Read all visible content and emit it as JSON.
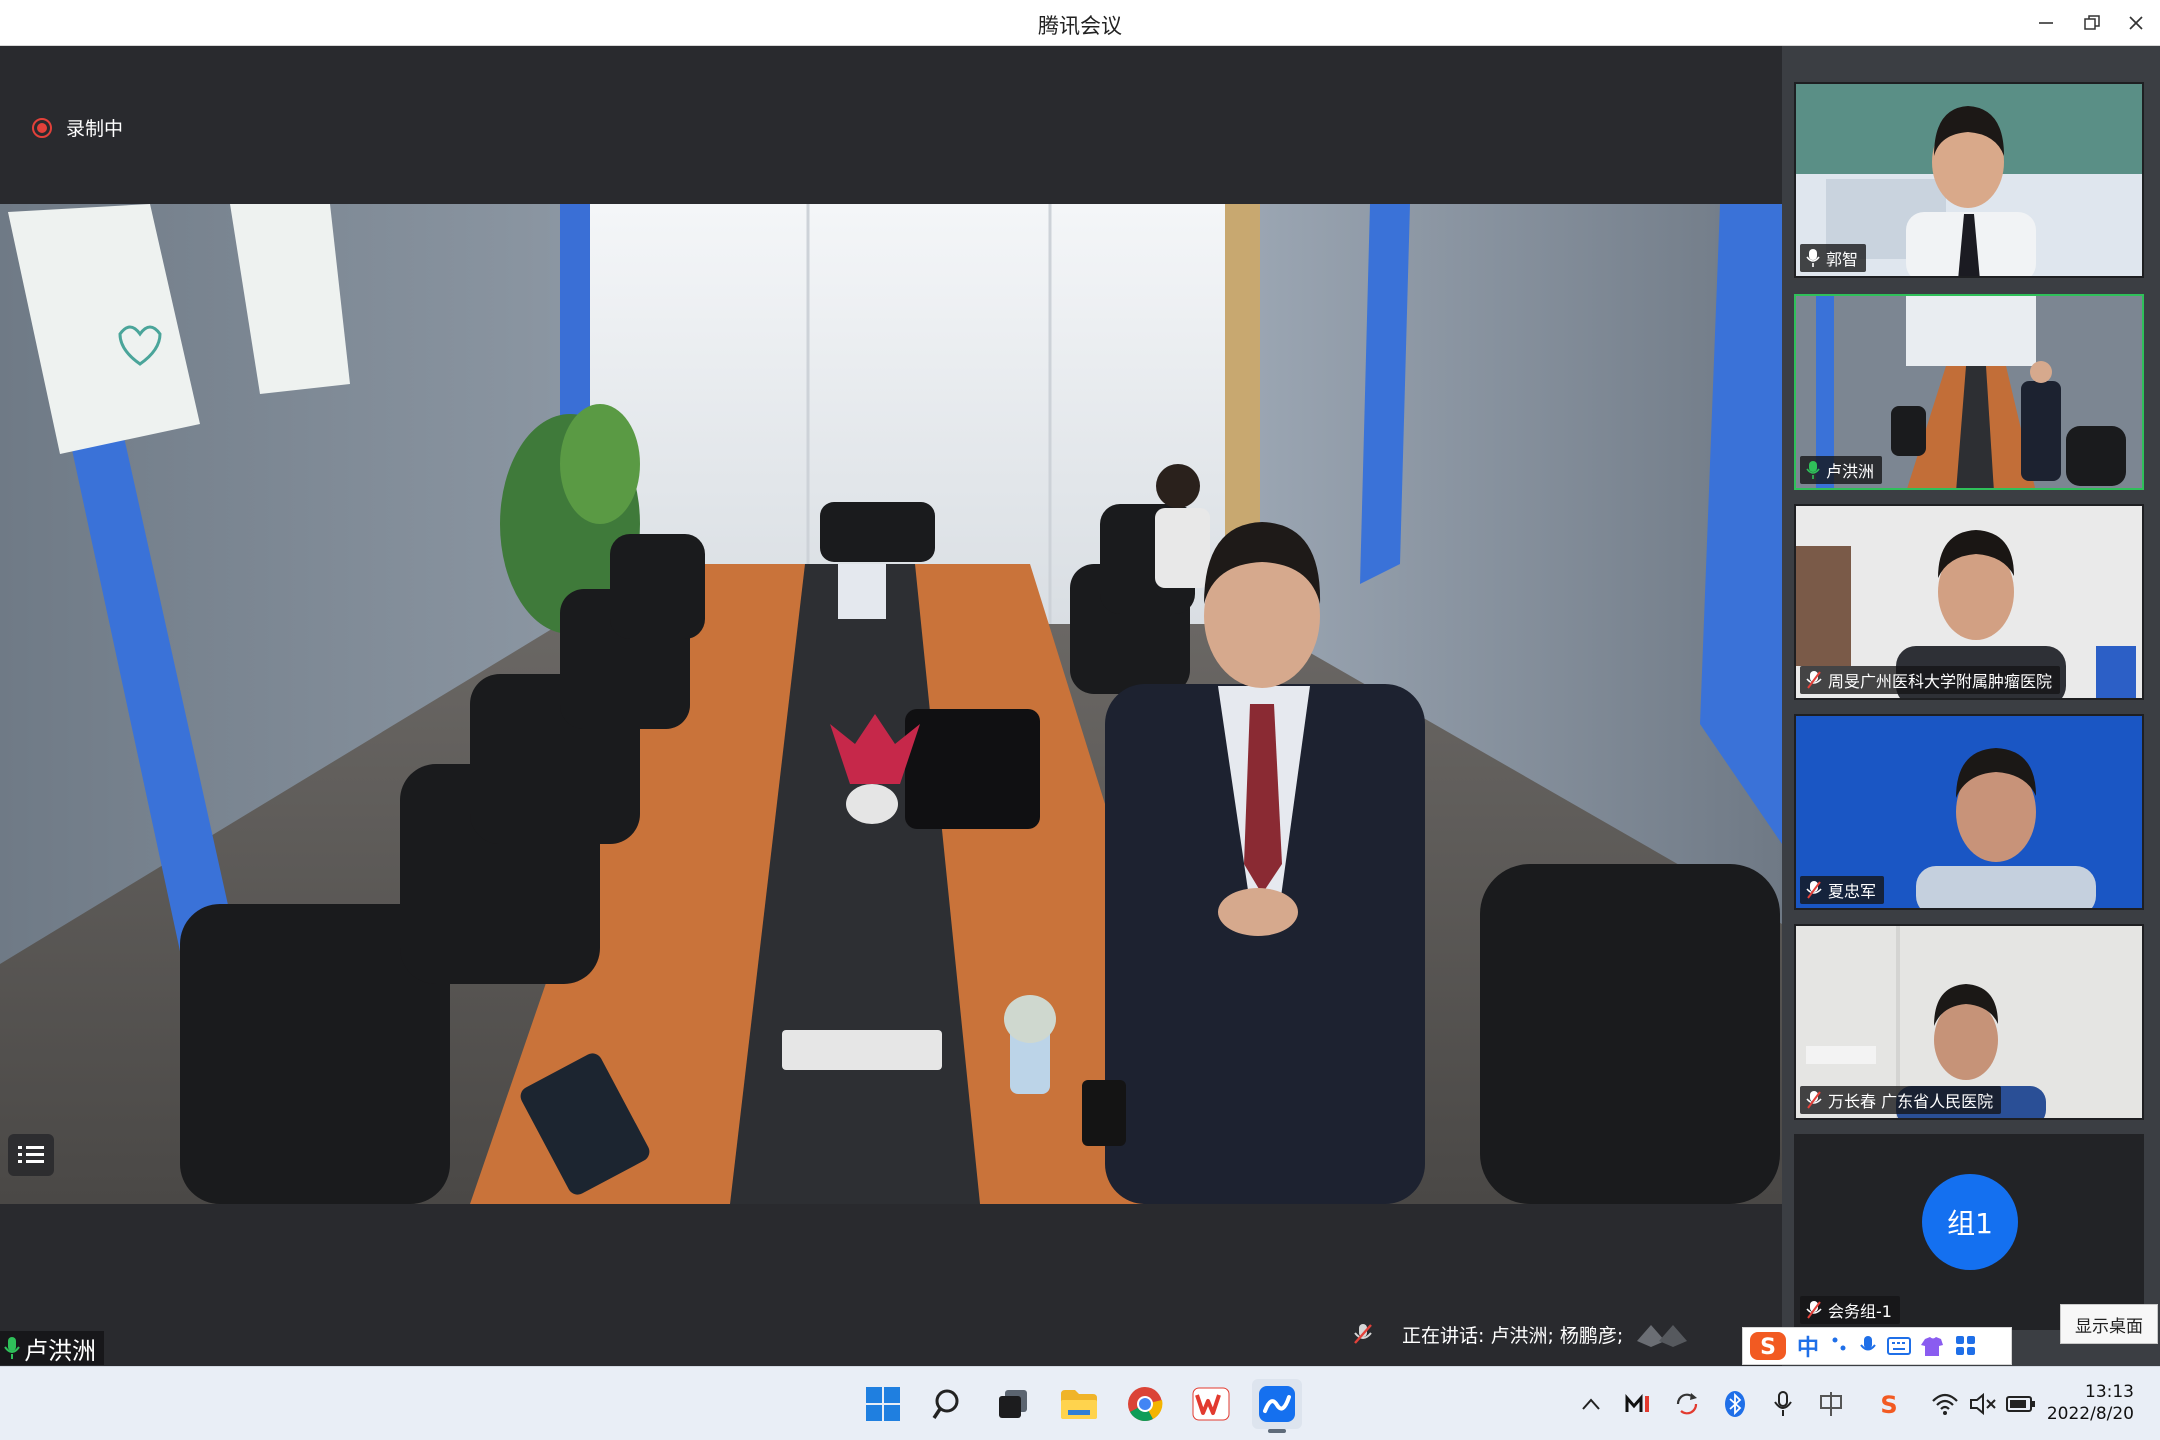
{
  "window": {
    "title": "腾讯会议"
  },
  "stage": {
    "recording_label": "录制中",
    "speaker_label": "卢洪洲",
    "speaking_prefix": "正在讲话: 卢洪洲; 杨鹏彦;"
  },
  "participants": [
    {
      "name": "郭智",
      "mic": "on",
      "active": false
    },
    {
      "name": "卢洪洲",
      "mic": "speaking",
      "active": true
    },
    {
      "name": "周旻广州医科大学附属肿瘤医院",
      "mic": "muted",
      "active": false
    },
    {
      "name": "夏忠军",
      "mic": "muted",
      "active": false
    },
    {
      "name": "万长春 广东省人民医院",
      "mic": "muted",
      "active": false
    },
    {
      "name": "会务组-1",
      "mic": "muted",
      "active": false,
      "avatar": "组1"
    }
  ],
  "tooltip": {
    "show_desktop": "显示桌面"
  },
  "ime": {
    "mode": "中"
  },
  "taskbar": {
    "apps": [
      "start-icon",
      "search-icon",
      "task-view-icon",
      "file-explorer-icon",
      "chrome-icon",
      "wps-icon",
      "tencent-meeting-icon"
    ],
    "time": "13:13",
    "date": "2022/8/20"
  },
  "colors": {
    "active_border": "#2fc05a",
    "group_avatar": "#1470f0",
    "recording": "#e2413a"
  }
}
